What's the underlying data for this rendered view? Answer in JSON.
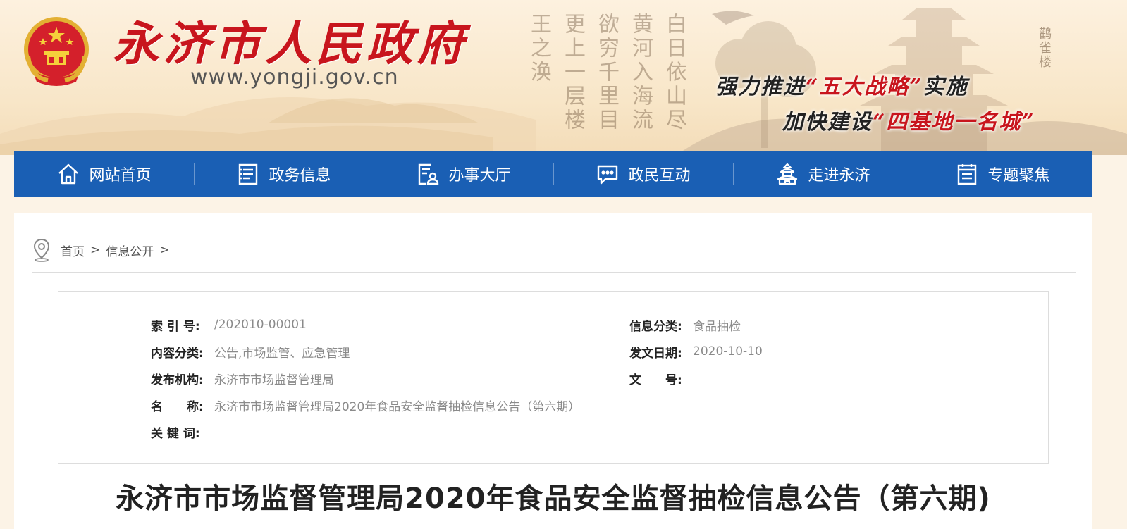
{
  "header": {
    "site_title": "永济市人民政府",
    "site_url": "www.yongji.gov.cn",
    "calligraphy_columns": [
      "白日依山尽",
      "黄河入海流",
      "欲穷千里目",
      "更上一层楼",
      "王之涣"
    ],
    "pagoda_label": "鹳雀楼",
    "slogan_1_a": "强力推进",
    "slogan_1_b": "“五大战略”",
    "slogan_1_c": "实施",
    "slogan_2_a": "加快建设",
    "slogan_2_b": "“四基地一名城”",
    "colors": {
      "title_red": "#c8151d",
      "nav_blue": "#1a5fb4"
    }
  },
  "nav": {
    "items": [
      {
        "label": "网站首页",
        "icon": "home-icon"
      },
      {
        "label": "政务信息",
        "icon": "document-list-icon"
      },
      {
        "label": "办事大厅",
        "icon": "service-form-icon"
      },
      {
        "label": "政民互动",
        "icon": "chat-bubble-icon"
      },
      {
        "label": "走进永济",
        "icon": "pavilion-icon"
      },
      {
        "label": "专题聚焦",
        "icon": "topic-page-icon"
      }
    ]
  },
  "breadcrumb": {
    "home": "首页",
    "sep1": ">",
    "section": "信息公开",
    "sep2": ">"
  },
  "meta": {
    "index_label": "索 引 号:",
    "index_value": "/202010-00001",
    "category_label": "信息分类:",
    "category_value": "食品抽检",
    "content_type_label": "内容分类:",
    "content_type_value": "公告,市场监管、应急管理",
    "date_label": "发文日期:",
    "date_value": "2020-10-10",
    "publisher_label": "发布机构:",
    "publisher_value": "永济市市场监督管理局",
    "doc_number_label": "文　　号:",
    "doc_number_value": "",
    "name_label": "名　　称:",
    "name_value": "永济市市场监督管理局2020年食品安全监督抽检信息公告（第六期）",
    "keywords_label": "关 键 词:",
    "keywords_value": ""
  },
  "article": {
    "title": "永济市市场监督管理局2020年食品安全监督抽检信息公告（第六期)"
  }
}
